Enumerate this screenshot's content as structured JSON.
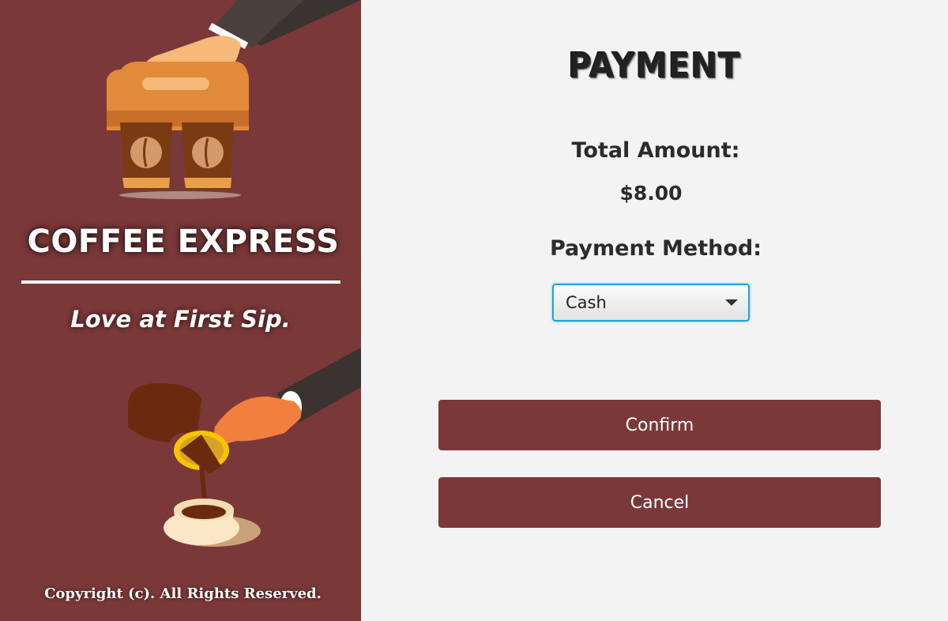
{
  "brand": {
    "name": "COFFEE EXPRESS",
    "tagline": "Love at First Sip.",
    "copyright": "Copyright (c). All Rights Reserved.",
    "panel_color": "#7b3839"
  },
  "payment": {
    "title": "PAYMENT",
    "total_label": "Total Amount:",
    "total_value": "$8.00",
    "method_label": "Payment Method:",
    "method_selected": "Cash",
    "confirm_label": "Confirm",
    "cancel_label": "Cancel",
    "button_color": "#7b3839",
    "select_focus_color": "#1ea4db"
  },
  "icons": {
    "top_illustration": "coffee-carrier-icon",
    "bottom_illustration": "coffee-pouring-icon",
    "dropdown_caret": "chevron-down-icon"
  }
}
